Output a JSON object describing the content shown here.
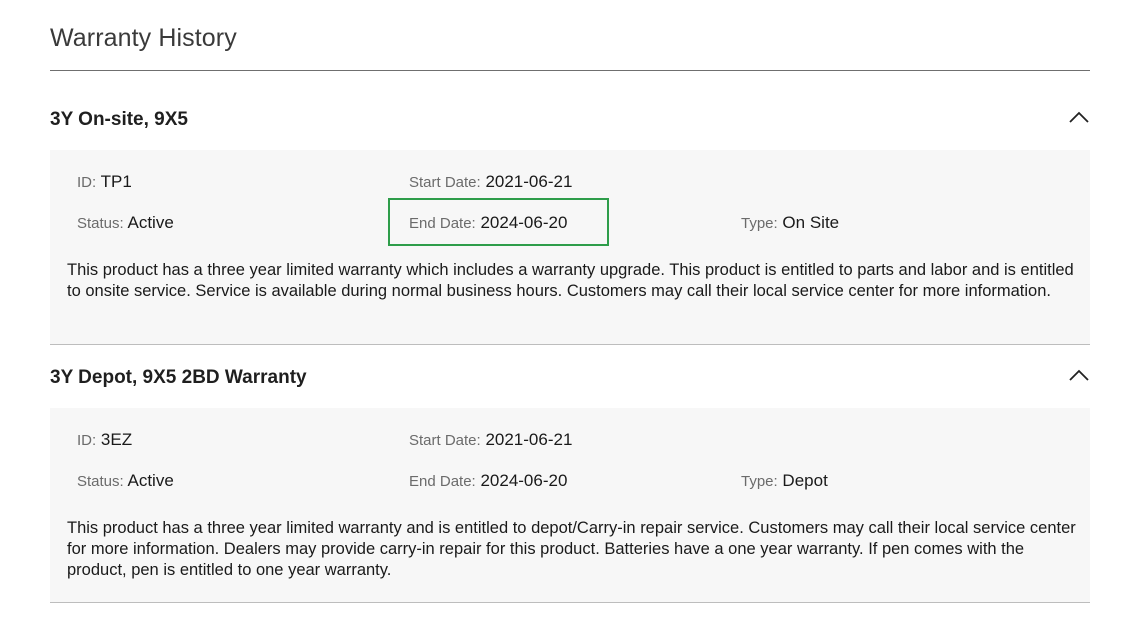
{
  "page": {
    "title": "Warranty History"
  },
  "colors": {
    "highlight": "#2e9d4a",
    "panel_bg": "#f7f7f7",
    "label_gray": "#6b6b6b"
  },
  "warranties": [
    {
      "title": "3Y On-site, 9X5",
      "expanded": true,
      "collapse_icon": "chevron-up-icon",
      "id_label": "ID:",
      "id_value": "TP1",
      "start_label": "Start Date:",
      "start_value": "2021-06-21",
      "status_label": "Status:",
      "status_value": "Active",
      "end_label": "End Date:",
      "end_value": "2024-06-20",
      "end_highlighted": true,
      "type_label": "Type:",
      "type_value": "On Site",
      "description": "This product has a three year limited warranty which includes a warranty upgrade. This product is entitled to parts and labor and is entitled to onsite service. Service is available during normal business hours. Customers may call their local service center for more information."
    },
    {
      "title": "3Y Depot, 9X5 2BD Warranty",
      "expanded": true,
      "collapse_icon": "chevron-up-icon",
      "id_label": "ID:",
      "id_value": "3EZ",
      "start_label": "Start Date:",
      "start_value": "2021-06-21",
      "status_label": "Status:",
      "status_value": "Active",
      "end_label": "End Date:",
      "end_value": "2024-06-20",
      "end_highlighted": false,
      "type_label": "Type:",
      "type_value": "Depot",
      "description": "This product has a three year limited warranty and is entitled to depot/Carry-in repair service. Customers may call their local service center for more information. Dealers may provide carry-in repair for this product. Batteries have a one year warranty. If pen comes with the product, pen is entitled to one year warranty."
    }
  ]
}
